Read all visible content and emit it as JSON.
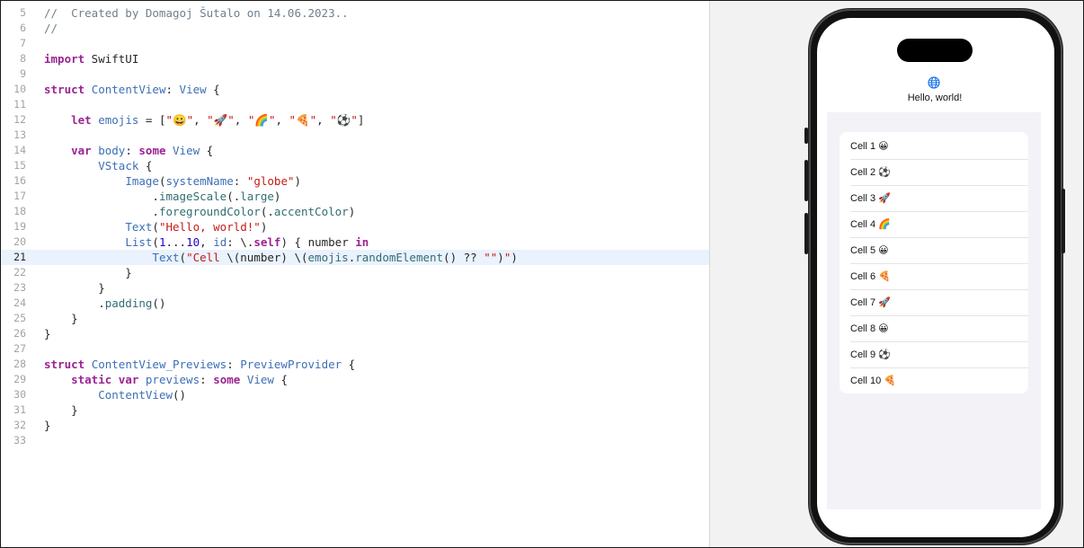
{
  "editor": {
    "current_line": "21",
    "lines": [
      {
        "n": "5",
        "tokens": [
          {
            "c": "cm",
            "t": "//  Created by Domagoj Šutalo on 14.06.2023.."
          }
        ]
      },
      {
        "n": "6",
        "tokens": [
          {
            "c": "cm",
            "t": "//"
          }
        ]
      },
      {
        "n": "7",
        "tokens": []
      },
      {
        "n": "8",
        "tokens": [
          {
            "c": "kw",
            "t": "import"
          },
          {
            "c": "pl",
            "t": " SwiftUI"
          }
        ]
      },
      {
        "n": "9",
        "tokens": []
      },
      {
        "n": "10",
        "tokens": [
          {
            "c": "kw",
            "t": "struct"
          },
          {
            "c": "pl",
            "t": " "
          },
          {
            "c": "ty",
            "t": "ContentView"
          },
          {
            "c": "pl",
            "t": ": "
          },
          {
            "c": "ty",
            "t": "View"
          },
          {
            "c": "pl",
            "t": " {"
          }
        ]
      },
      {
        "n": "11",
        "tokens": []
      },
      {
        "n": "12",
        "tokens": [
          {
            "c": "pl",
            "t": "    "
          },
          {
            "c": "kw",
            "t": "let"
          },
          {
            "c": "pl",
            "t": " "
          },
          {
            "c": "ty",
            "t": "emojis"
          },
          {
            "c": "pl",
            "t": " = ["
          },
          {
            "c": "st",
            "t": "\"😀\""
          },
          {
            "c": "pl",
            "t": ", "
          },
          {
            "c": "st",
            "t": "\"🚀\""
          },
          {
            "c": "pl",
            "t": ", "
          },
          {
            "c": "st",
            "t": "\"🌈\""
          },
          {
            "c": "pl",
            "t": ", "
          },
          {
            "c": "st",
            "t": "\"🍕\""
          },
          {
            "c": "pl",
            "t": ", "
          },
          {
            "c": "st",
            "t": "\"⚽\""
          },
          {
            "c": "pl",
            "t": "]"
          }
        ]
      },
      {
        "n": "13",
        "tokens": []
      },
      {
        "n": "14",
        "tokens": [
          {
            "c": "pl",
            "t": "    "
          },
          {
            "c": "kw",
            "t": "var"
          },
          {
            "c": "pl",
            "t": " "
          },
          {
            "c": "ty",
            "t": "body"
          },
          {
            "c": "pl",
            "t": ": "
          },
          {
            "c": "kw",
            "t": "some"
          },
          {
            "c": "pl",
            "t": " "
          },
          {
            "c": "ty",
            "t": "View"
          },
          {
            "c": "pl",
            "t": " {"
          }
        ]
      },
      {
        "n": "15",
        "tokens": [
          {
            "c": "pl",
            "t": "        "
          },
          {
            "c": "ty",
            "t": "VStack"
          },
          {
            "c": "pl",
            "t": " {"
          }
        ]
      },
      {
        "n": "16",
        "tokens": [
          {
            "c": "pl",
            "t": "            "
          },
          {
            "c": "ty",
            "t": "Image"
          },
          {
            "c": "pl",
            "t": "("
          },
          {
            "c": "ty",
            "t": "systemName"
          },
          {
            "c": "pl",
            "t": ": "
          },
          {
            "c": "st",
            "t": "\"globe\""
          },
          {
            "c": "pl",
            "t": ")"
          }
        ]
      },
      {
        "n": "17",
        "tokens": [
          {
            "c": "pl",
            "t": "                ."
          },
          {
            "c": "fn",
            "t": "imageScale"
          },
          {
            "c": "pl",
            "t": "(."
          },
          {
            "c": "fn",
            "t": "large"
          },
          {
            "c": "pl",
            "t": ")"
          }
        ]
      },
      {
        "n": "18",
        "tokens": [
          {
            "c": "pl",
            "t": "                ."
          },
          {
            "c": "fn",
            "t": "foregroundColor"
          },
          {
            "c": "pl",
            "t": "(."
          },
          {
            "c": "fn",
            "t": "accentColor"
          },
          {
            "c": "pl",
            "t": ")"
          }
        ]
      },
      {
        "n": "19",
        "tokens": [
          {
            "c": "pl",
            "t": "            "
          },
          {
            "c": "ty",
            "t": "Text"
          },
          {
            "c": "pl",
            "t": "("
          },
          {
            "c": "st",
            "t": "\"Hello, world!\""
          },
          {
            "c": "pl",
            "t": ")"
          }
        ]
      },
      {
        "n": "20",
        "tokens": [
          {
            "c": "pl",
            "t": "            "
          },
          {
            "c": "ty",
            "t": "List"
          },
          {
            "c": "pl",
            "t": "("
          },
          {
            "c": "nm",
            "t": "1"
          },
          {
            "c": "pl",
            "t": "..."
          },
          {
            "c": "nm",
            "t": "10"
          },
          {
            "c": "pl",
            "t": ", "
          },
          {
            "c": "ty",
            "t": "id"
          },
          {
            "c": "pl",
            "t": ": \\."
          },
          {
            "c": "kw",
            "t": "self"
          },
          {
            "c": "pl",
            "t": ") { number "
          },
          {
            "c": "kw",
            "t": "in"
          }
        ]
      },
      {
        "n": "21",
        "tokens": [
          {
            "c": "pl",
            "t": "                "
          },
          {
            "c": "ty",
            "t": "Text"
          },
          {
            "c": "pl",
            "t": "("
          },
          {
            "c": "st",
            "t": "\"Cell "
          },
          {
            "c": "pl",
            "t": "\\(number) \\("
          },
          {
            "c": "fn",
            "t": "emojis"
          },
          {
            "c": "pl",
            "t": "."
          },
          {
            "c": "fn",
            "t": "randomElement"
          },
          {
            "c": "pl",
            "t": "() ?? "
          },
          {
            "c": "st",
            "t": "\"\""
          },
          {
            "c": "pl",
            "t": ")"
          },
          {
            "c": "st",
            "t": "\""
          },
          {
            "c": "pl",
            "t": ")"
          }
        ]
      },
      {
        "n": "22",
        "tokens": [
          {
            "c": "pl",
            "t": "            }"
          }
        ]
      },
      {
        "n": "23",
        "tokens": [
          {
            "c": "pl",
            "t": "        }"
          }
        ]
      },
      {
        "n": "24",
        "tokens": [
          {
            "c": "pl",
            "t": "        ."
          },
          {
            "c": "fn",
            "t": "padding"
          },
          {
            "c": "pl",
            "t": "()"
          }
        ]
      },
      {
        "n": "25",
        "tokens": [
          {
            "c": "pl",
            "t": "    }"
          }
        ]
      },
      {
        "n": "26",
        "tokens": [
          {
            "c": "pl",
            "t": "}"
          }
        ]
      },
      {
        "n": "27",
        "tokens": []
      },
      {
        "n": "28",
        "tokens": [
          {
            "c": "kw",
            "t": "struct"
          },
          {
            "c": "pl",
            "t": " "
          },
          {
            "c": "ty",
            "t": "ContentView_Previews"
          },
          {
            "c": "pl",
            "t": ": "
          },
          {
            "c": "ty",
            "t": "PreviewProvider"
          },
          {
            "c": "pl",
            "t": " {"
          }
        ]
      },
      {
        "n": "29",
        "tokens": [
          {
            "c": "pl",
            "t": "    "
          },
          {
            "c": "kw",
            "t": "static"
          },
          {
            "c": "pl",
            "t": " "
          },
          {
            "c": "kw",
            "t": "var"
          },
          {
            "c": "pl",
            "t": " "
          },
          {
            "c": "ty",
            "t": "previews"
          },
          {
            "c": "pl",
            "t": ": "
          },
          {
            "c": "kw",
            "t": "some"
          },
          {
            "c": "pl",
            "t": " "
          },
          {
            "c": "ty",
            "t": "View"
          },
          {
            "c": "pl",
            "t": " {"
          }
        ]
      },
      {
        "n": "30",
        "tokens": [
          {
            "c": "pl",
            "t": "        "
          },
          {
            "c": "ty",
            "t": "ContentView"
          },
          {
            "c": "pl",
            "t": "()"
          }
        ]
      },
      {
        "n": "31",
        "tokens": [
          {
            "c": "pl",
            "t": "    }"
          }
        ]
      },
      {
        "n": "32",
        "tokens": [
          {
            "c": "pl",
            "t": "}"
          }
        ]
      },
      {
        "n": "33",
        "tokens": []
      }
    ]
  },
  "preview": {
    "globe_icon": "globe-icon",
    "accent_color": "#1a73e8",
    "hello_text": "Hello, world!",
    "cells": [
      {
        "label": "Cell 1",
        "emoji": "😀"
      },
      {
        "label": "Cell 2",
        "emoji": "⚽"
      },
      {
        "label": "Cell 3",
        "emoji": "🚀"
      },
      {
        "label": "Cell 4",
        "emoji": "🌈"
      },
      {
        "label": "Cell 5",
        "emoji": "😀"
      },
      {
        "label": "Cell 6",
        "emoji": "🍕"
      },
      {
        "label": "Cell 7",
        "emoji": "🚀"
      },
      {
        "label": "Cell 8",
        "emoji": "😀"
      },
      {
        "label": "Cell 9",
        "emoji": "⚽"
      },
      {
        "label": "Cell 10",
        "emoji": "🍕"
      }
    ]
  },
  "colors": {
    "keyword": "#9b2393",
    "type": "#3c6fb6",
    "string": "#c41a16",
    "comment": "#707f8c",
    "current_line_bg": "#eaf2fd",
    "list_background": "#f2f2f7"
  }
}
